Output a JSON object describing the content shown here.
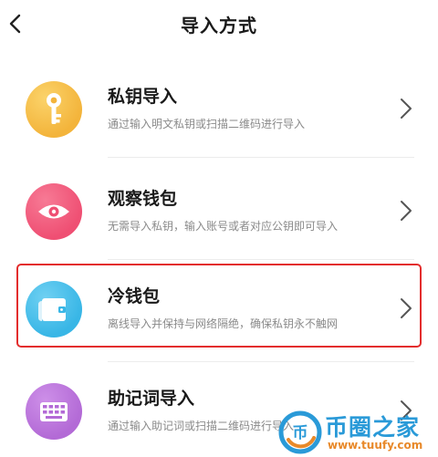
{
  "header": {
    "title": "导入方式",
    "back_icon": "chevron-left-icon"
  },
  "items": [
    {
      "label": "私钥导入",
      "description": "通过输入明文私钥或扫描二维码进行导入",
      "icon": "key-icon",
      "color": "#f3b43b"
    },
    {
      "label": "观察钱包",
      "description": "无需导入私钥，输入账号或者对应公钥即可导入",
      "icon": "eye-icon",
      "color": "#ef4f73"
    },
    {
      "label": "冷钱包",
      "description": "离线导入并保持与网络隔绝，确保私钥永不触网",
      "icon": "wallet-icon",
      "color": "#38b6e6",
      "highlighted": true
    },
    {
      "label": "助记词导入",
      "description": "通过输入助记词或扫描二维码进行导入",
      "icon": "keyboard-icon",
      "color": "#b36ad6"
    }
  ],
  "highlight_color": "#e32d2d",
  "watermark": {
    "title": "币圈之家",
    "url": "www.tuufy.com"
  }
}
